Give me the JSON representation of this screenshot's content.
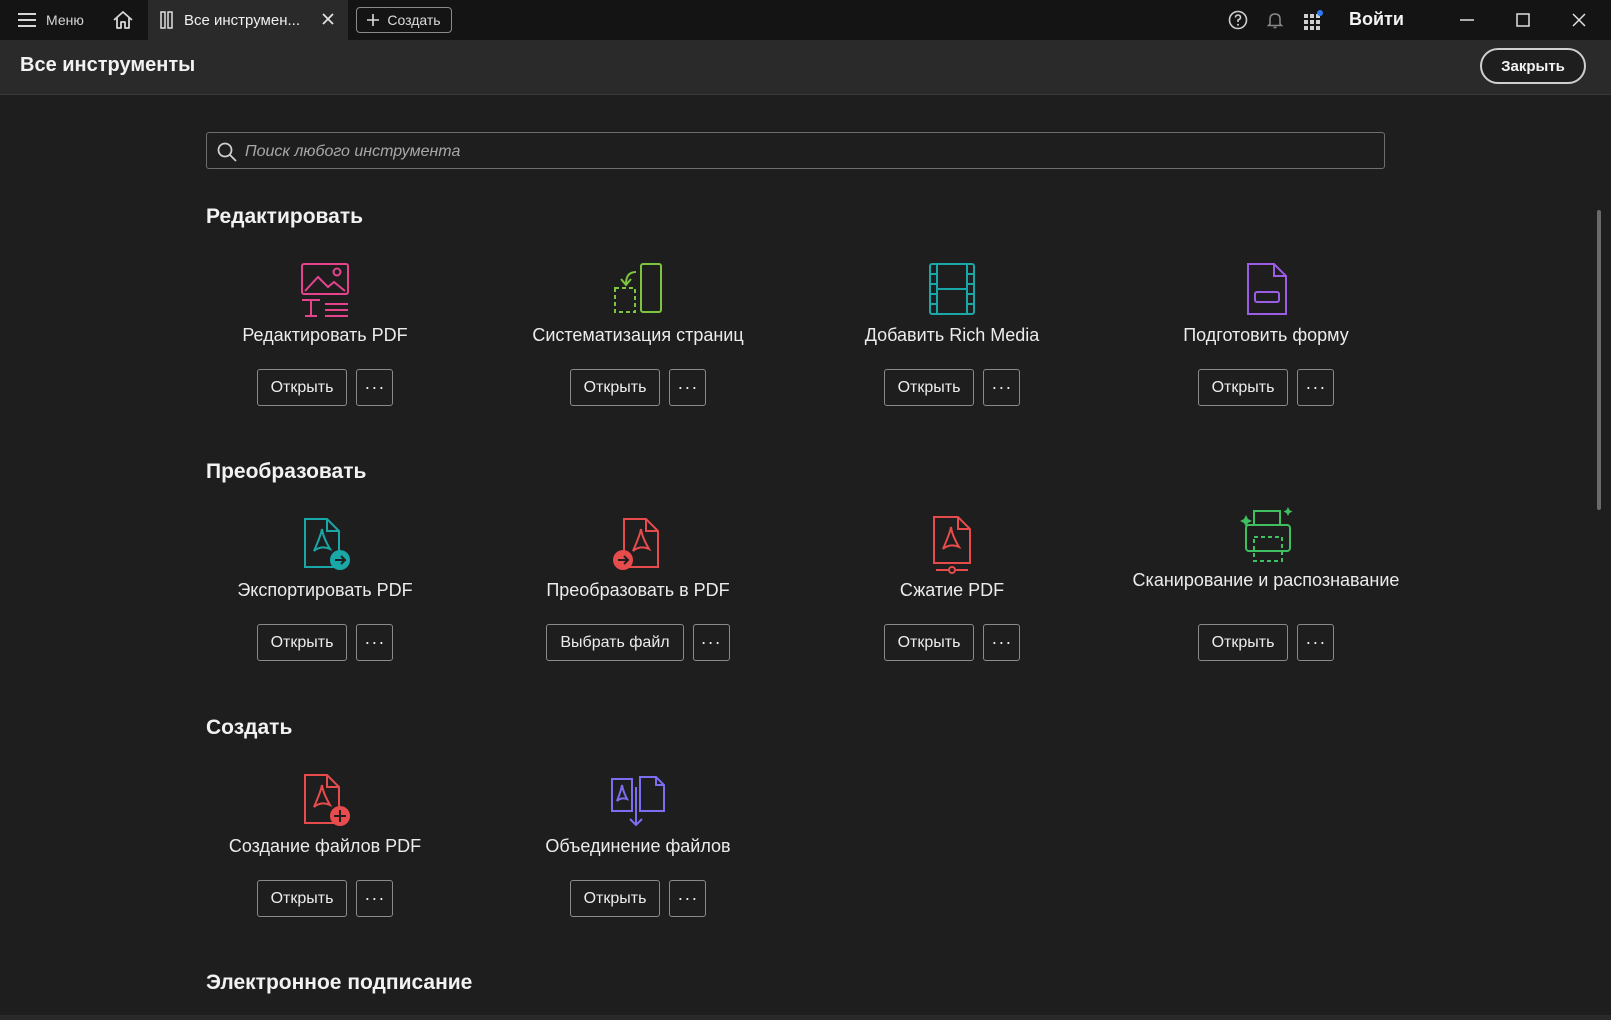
{
  "titlebar": {
    "menu_label": "Меню",
    "tab_title": "Все инструмен...",
    "create_label": "Создать",
    "signin_label": "Войти"
  },
  "header": {
    "title": "Все инструменты",
    "close_label": "Закрыть"
  },
  "search": {
    "placeholder": "Поиск любого инструмента"
  },
  "sections": [
    {
      "title": "Редактировать",
      "tools": [
        {
          "label": "Редактировать PDF",
          "button": "Открыть",
          "icon": "edit-pdf-icon",
          "color": "#e7428c"
        },
        {
          "label": "Систематизация страниц",
          "button": "Открыть",
          "icon": "organize-pages-icon",
          "color": "#7dc43f"
        },
        {
          "label": "Добавить Rich Media",
          "button": "Открыть",
          "icon": "rich-media-icon",
          "color": "#1aa7a7"
        },
        {
          "label": "Подготовить форму",
          "button": "Открыть",
          "icon": "prepare-form-icon",
          "color": "#9b5de5"
        }
      ]
    },
    {
      "title": "Преобразовать",
      "tools": [
        {
          "label": "Экспортировать PDF",
          "button": "Открыть",
          "icon": "export-pdf-icon",
          "color": "#1aa7a7"
        },
        {
          "label": "Преобразовать в PDF",
          "button": "Выбрать файл",
          "icon": "convert-to-pdf-icon",
          "color": "#e84b4b"
        },
        {
          "label": "Сжатие PDF",
          "button": "Открыть",
          "icon": "compress-pdf-icon",
          "color": "#e84b4b"
        },
        {
          "label": "Сканирование и распознавание",
          "button": "Открыть",
          "icon": "scan-ocr-icon",
          "color": "#3fbf5f"
        }
      ]
    },
    {
      "title": "Создать",
      "tools": [
        {
          "label": "Создание файлов PDF",
          "button": "Открыть",
          "icon": "create-pdf-icon",
          "color": "#e84b4b"
        },
        {
          "label": "Объединение файлов",
          "button": "Открыть",
          "icon": "combine-files-icon",
          "color": "#7b6ef0"
        }
      ]
    },
    {
      "title": "Электронное подписание",
      "tools": []
    }
  ],
  "more_label": "···"
}
